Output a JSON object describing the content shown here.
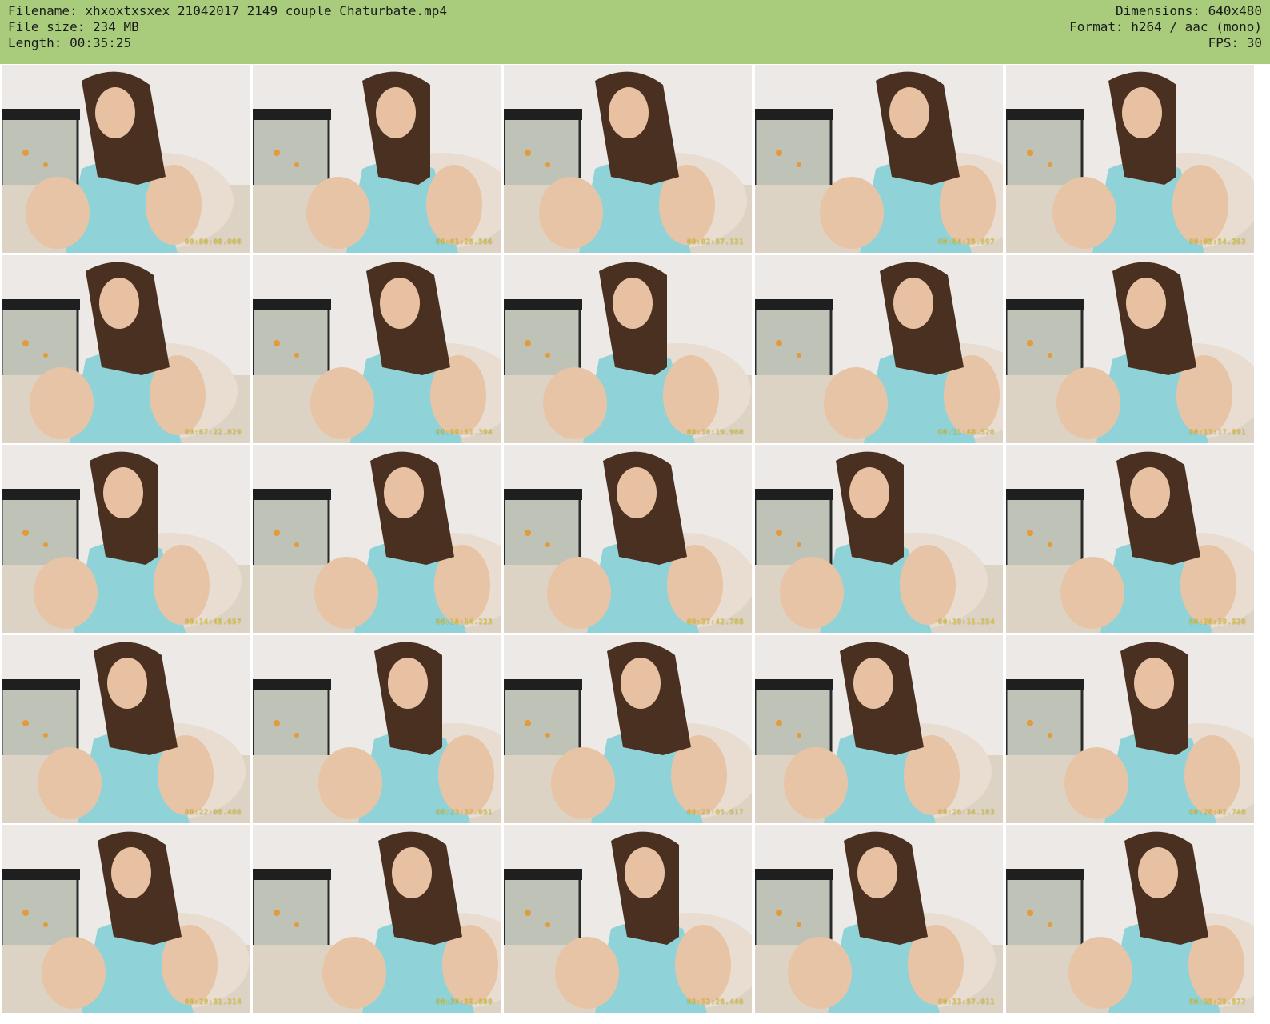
{
  "header": {
    "filename": "Filename: xhxoxtxsxex_21042017_2149_couple_Chaturbate.mp4",
    "filesize": "File size: 234 MB",
    "length": "Length: 00:35:25",
    "dimensions": "Dimensions: 640x480",
    "format": "Format: h264 / aac (mono)",
    "fps": "FPS: 30"
  },
  "colors": {
    "header_bg": "#a9cc7c",
    "top_color": "#8fd3d8",
    "hair": "#4a3020",
    "wall": "#ece9e6",
    "couch": "#ddd3c4",
    "timestamp": "#e8d24a"
  },
  "thumbnails": [
    {
      "timestamp": "00:00:00.000"
    },
    {
      "timestamp": "00:01:28.566"
    },
    {
      "timestamp": "00:02:57.131"
    },
    {
      "timestamp": "00:04:25.697"
    },
    {
      "timestamp": "00:05:54.263"
    },
    {
      "timestamp": "00:07:22.829"
    },
    {
      "timestamp": "00:08:51.394"
    },
    {
      "timestamp": "00:10:19.960"
    },
    {
      "timestamp": "00:11:48.526"
    },
    {
      "timestamp": "00:13:17.091"
    },
    {
      "timestamp": "00:14:45.657"
    },
    {
      "timestamp": "00:16:14.223"
    },
    {
      "timestamp": "00:17:42.788"
    },
    {
      "timestamp": "00:19:11.354"
    },
    {
      "timestamp": "00:20:39.920"
    },
    {
      "timestamp": "00:22:08.486"
    },
    {
      "timestamp": "00:23:37.051"
    },
    {
      "timestamp": "00:25:05.617"
    },
    {
      "timestamp": "00:26:34.183"
    },
    {
      "timestamp": "00:28:02.748"
    },
    {
      "timestamp": "00:29:31.314"
    },
    {
      "timestamp": "00:30:59.880"
    },
    {
      "timestamp": "00:32:28.446"
    },
    {
      "timestamp": "00:33:57.011"
    },
    {
      "timestamp": "00:35:25.577"
    }
  ]
}
